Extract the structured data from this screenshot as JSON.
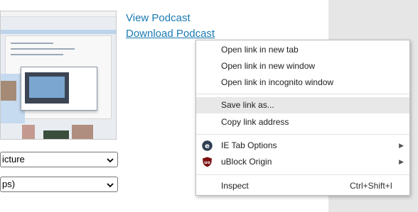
{
  "links": {
    "view_podcast": "View Podcast",
    "download_podcast": "Download Podcast"
  },
  "selects": [
    {
      "value": "icture"
    },
    {
      "value": "ps)"
    }
  ],
  "context_menu": {
    "items": [
      {
        "label": "Open link in new tab"
      },
      {
        "label": "Open link in new window"
      },
      {
        "label": "Open link in incognito window"
      },
      {
        "label": "Save link as..."
      },
      {
        "label": "Copy link address"
      },
      {
        "label": "IE Tab Options",
        "icon": "ie-tab-icon"
      },
      {
        "label": "uBlock Origin",
        "icon": "ublock-origin-icon"
      },
      {
        "label": "Inspect",
        "shortcut": "Ctrl+Shift+I"
      }
    ]
  },
  "colors": {
    "link": "#1b7ab3",
    "menu_hover": "#e8e8e8",
    "ie_tab_icon": "#2e3f52",
    "ublock_icon": "#7b0f0f"
  }
}
